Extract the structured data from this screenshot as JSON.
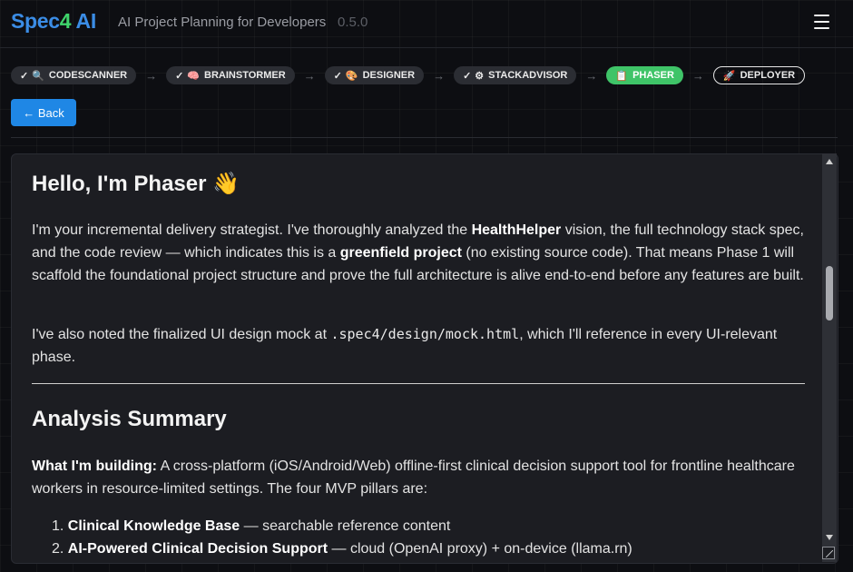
{
  "app": {
    "logo": {
      "part1": "Spec",
      "part2": "4",
      "part3": " AI"
    },
    "subtitle": "AI Project Planning for Developers",
    "version": "0.5.0"
  },
  "pipeline": {
    "steps": [
      {
        "check": "✓",
        "icon": "🔍",
        "label": "CODESCANNER",
        "status": "done"
      },
      {
        "check": "✓",
        "icon": "🧠",
        "label": "BRAINSTORMER",
        "status": "done"
      },
      {
        "check": "✓",
        "icon": "🎨",
        "label": "DESIGNER",
        "status": "done"
      },
      {
        "check": "✓",
        "icon": "⚙",
        "label": "STACKADVISOR",
        "status": "done"
      },
      {
        "check": "",
        "icon": "📋",
        "label": "PHASER",
        "status": "active"
      },
      {
        "check": "",
        "icon": "🚀",
        "label": "DEPLOYER",
        "status": "pending"
      }
    ],
    "arrow": "→"
  },
  "back_button": "← Back",
  "message": {
    "greeting": "Hello, I'm Phaser 👋",
    "intro": {
      "a": "I'm your incremental delivery strategist. I've thoroughly analyzed the ",
      "b": "HealthHelper",
      "c": " vision, the full technology stack spec, and the code review — which indicates this is a ",
      "d": "greenfield project",
      "e": " (no existing source code). That means Phase 1 will scaffold the foundational project structure and prove the full architecture is alive end-to-end before any features are built."
    },
    "mock": {
      "a": "I've also noted the finalized UI design mock at ",
      "code": ".spec4/design/mock.html",
      "b": ", which I'll reference in every UI-relevant phase."
    },
    "summary_heading": "Analysis Summary",
    "building": {
      "label": "What I'm building:",
      "text": " A cross-platform (iOS/Android/Web) offline-first clinical decision support tool for frontline healthcare workers in resource-limited settings. The four MVP pillars are:"
    },
    "pillars": [
      {
        "num": "1.",
        "title": "Clinical Knowledge Base",
        "desc": " — searchable reference content"
      },
      {
        "num": "2.",
        "title": "AI-Powered Clinical Decision Support",
        "desc": " — cloud (OpenAI proxy) + on-device (llama.rn)"
      }
    ]
  },
  "icons": {
    "menu": "hamburger-menu-icon",
    "scroll_up": "scroll-up-arrow-icon",
    "scroll_down": "scroll-down-arrow-icon",
    "resize": "resize-grip-icon"
  },
  "colors": {
    "accent_blue": "#1f87e5",
    "logo_blue": "#3b8de6",
    "logo_green": "#3fd46b",
    "active_step": "#3fc468",
    "background": "#0d0e12",
    "panel": "#1c1d22"
  }
}
